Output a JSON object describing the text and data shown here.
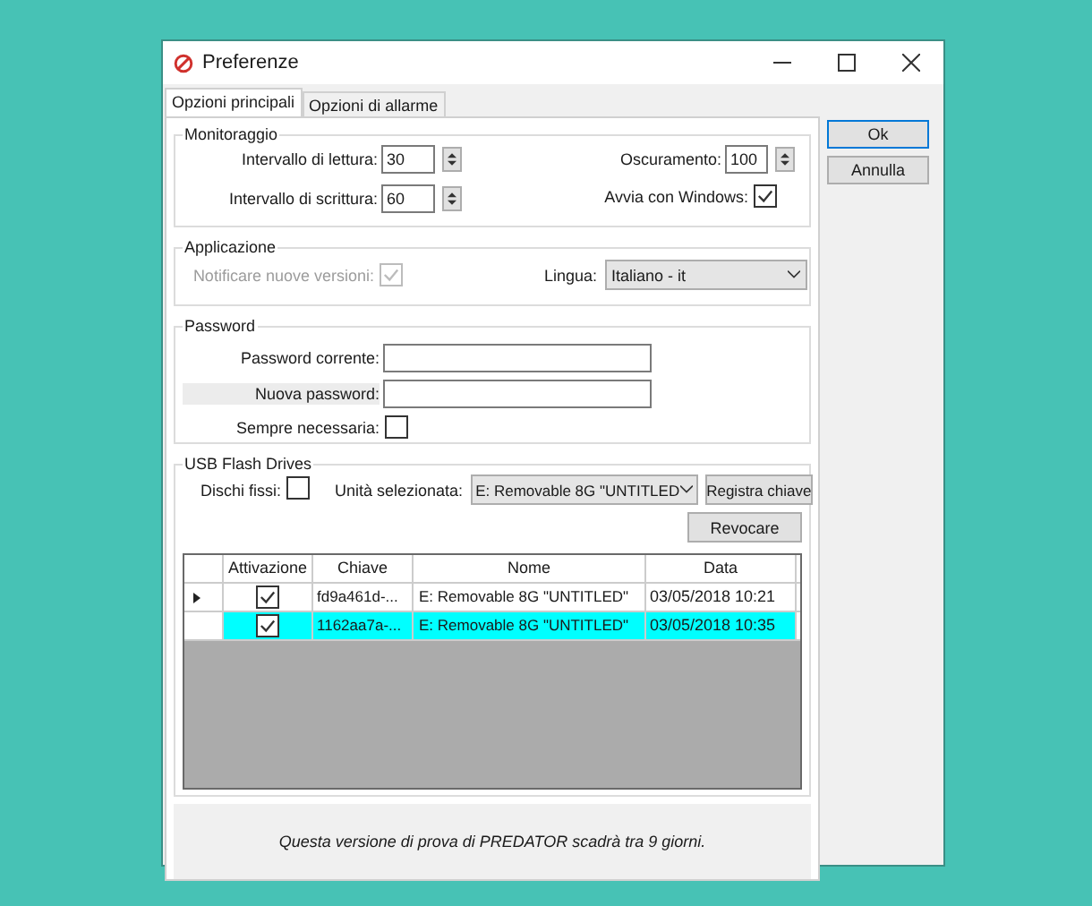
{
  "window": {
    "title": "Preferenze"
  },
  "tabs": [
    {
      "label": "Opzioni principali",
      "selected": true
    },
    {
      "label": "Opzioni di allarme",
      "selected": false
    }
  ],
  "buttons": [
    {
      "label": "Ok",
      "default": true
    },
    {
      "label": "Annulla",
      "default": false
    }
  ],
  "monitoring": {
    "title": "Monitoraggio",
    "read_interval": {
      "label": "Intervallo di lettura:",
      "value": "30"
    },
    "write_interval": {
      "label": "Intervallo di scrittura:",
      "value": "60"
    },
    "dimming": {
      "label": "Oscuramento:",
      "value": "100"
    },
    "start_with_windows": {
      "label": "Avvia con Windows:",
      "checked": true
    }
  },
  "application": {
    "title": "Applicazione",
    "notify": {
      "label": "Notificare nuove versioni:",
      "checked": true,
      "disabled": true
    },
    "language": {
      "label": "Lingua:",
      "value": "Italiano - it"
    }
  },
  "password": {
    "title": "Password",
    "current": {
      "label": "Password corrente:"
    },
    "new": {
      "label": "Nuova password:",
      "highlighted": true
    },
    "always_required": {
      "label": "Sempre necessaria:",
      "checked": false
    }
  },
  "usb": {
    "title": "USB Flash Drives",
    "fixed_disks": {
      "label": "Dischi fissi:",
      "checked": false
    },
    "selected_drive": {
      "label": "Unità selezionata:",
      "value": "E: Removable 8G \"UNTITLED"
    },
    "register_button": "Registra chiave",
    "revoke_button": "Revocare",
    "table": {
      "columns": [
        "Attivazione",
        "Chiave",
        "Nome",
        "Data"
      ],
      "rows": [
        {
          "current": true,
          "selected": false,
          "activated": true,
          "key": "fd9a461d-...",
          "name": "E: Removable 8G \"UNTITLED\"",
          "date": "03/05/2018 10:21"
        },
        {
          "current": false,
          "selected": true,
          "activated": true,
          "key": "1162aa7a-...",
          "name": "E: Removable 8G \"UNTITLED\"",
          "date": "03/05/2018 10:35"
        }
      ]
    }
  },
  "notice": "Questa versione di prova di PREDATOR scadrà tra 9 giorni."
}
